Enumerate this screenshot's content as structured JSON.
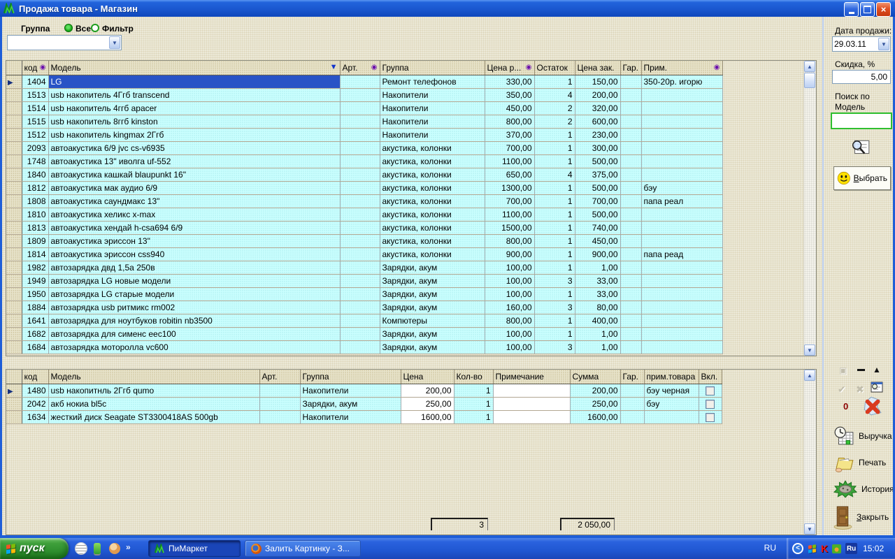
{
  "window": {
    "title": "Продажа товара - Магазин"
  },
  "toolbar": {
    "group_label": "Группа",
    "radio_all_label": "Все",
    "radio_filter_label": "Фильтр",
    "group_value": ""
  },
  "main_table": {
    "headers": [
      {
        "label": "код",
        "icon": "filter"
      },
      {
        "label": "Модель",
        "icon": "sort-desc"
      },
      {
        "label": "Арт.",
        "icon": "filter"
      },
      {
        "label": "Группа"
      },
      {
        "label": "Цена р...",
        "icon": "filter"
      },
      {
        "label": "Остаток"
      },
      {
        "label": "Цена зак."
      },
      {
        "label": "Гар."
      },
      {
        "label": "Прим.",
        "icon": "filter"
      }
    ],
    "selected_row": 0,
    "rows": [
      {
        "code": "1404",
        "model": "LG",
        "art": "",
        "group": "Ремонт телефонов",
        "price": "330,00",
        "stock": "1",
        "purchase": "150,00",
        "gar": "",
        "note": "350-20р. игорю"
      },
      {
        "code": "1513",
        "model": "usb накопитель 4Ггб transcend",
        "art": "",
        "group": "Накопители",
        "price": "350,00",
        "stock": "4",
        "purchase": "200,00",
        "gar": "",
        "note": ""
      },
      {
        "code": "1514",
        "model": "usb накопитель 4ггб apacer",
        "art": "",
        "group": "Накопители",
        "price": "450,00",
        "stock": "2",
        "purchase": "320,00",
        "gar": "",
        "note": ""
      },
      {
        "code": "1515",
        "model": "usb накопитель 8ггб kinston",
        "art": "",
        "group": "Накопители",
        "price": "800,00",
        "stock": "2",
        "purchase": "600,00",
        "gar": "",
        "note": ""
      },
      {
        "code": "1512",
        "model": "usb накопитель kingmax 2Ггб",
        "art": "",
        "group": "Накопители",
        "price": "370,00",
        "stock": "1",
        "purchase": "230,00",
        "gar": "",
        "note": ""
      },
      {
        "code": "2093",
        "model": "автоакустика 6/9 jvc cs-v6935",
        "art": "",
        "group": "акустика, колонки",
        "price": "700,00",
        "stock": "1",
        "purchase": "300,00",
        "gar": "",
        "note": ""
      },
      {
        "code": "1748",
        "model": "автоакустика 13\" иволга uf-552",
        "art": "",
        "group": "акустика, колонки",
        "price": "1100,00",
        "stock": "1",
        "purchase": "500,00",
        "gar": "",
        "note": ""
      },
      {
        "code": "1840",
        "model": "автоакустика кашкай blaupunkt 16\"",
        "art": "",
        "group": "акустика, колонки",
        "price": "650,00",
        "stock": "4",
        "purchase": "375,00",
        "gar": "",
        "note": ""
      },
      {
        "code": "1812",
        "model": "автоакустика мак аудио 6/9",
        "art": "",
        "group": "акустика, колонки",
        "price": "1300,00",
        "stock": "1",
        "purchase": "500,00",
        "gar": "",
        "note": "бэу"
      },
      {
        "code": "1808",
        "model": "автоакустика саундмакс 13\"",
        "art": "",
        "group": "акустика, колонки",
        "price": "700,00",
        "stock": "1",
        "purchase": "700,00",
        "gar": "",
        "note": "папа реал"
      },
      {
        "code": "1810",
        "model": "автоакустика хеликс x-max",
        "art": "",
        "group": "акустика, колонки",
        "price": "1100,00",
        "stock": "1",
        "purchase": "500,00",
        "gar": "",
        "note": ""
      },
      {
        "code": "1813",
        "model": "автоакустика хендай h-csa694 6/9",
        "art": "",
        "group": "акустика, колонки",
        "price": "1500,00",
        "stock": "1",
        "purchase": "740,00",
        "gar": "",
        "note": ""
      },
      {
        "code": "1809",
        "model": "автоакустика эриссон 13\"",
        "art": "",
        "group": "акустика, колонки",
        "price": "800,00",
        "stock": "1",
        "purchase": "450,00",
        "gar": "",
        "note": ""
      },
      {
        "code": "1814",
        "model": "автоакустика эриссон css940",
        "art": "",
        "group": "акустика, колонки",
        "price": "900,00",
        "stock": "1",
        "purchase": "900,00",
        "gar": "",
        "note": "папа реад"
      },
      {
        "code": "1982",
        "model": "автозарядка двд 1,5а 250в",
        "art": "",
        "group": "Зарядки, акум",
        "price": "100,00",
        "stock": "1",
        "purchase": "1,00",
        "gar": "",
        "note": ""
      },
      {
        "code": "1949",
        "model": "автозарядка LG новые модели",
        "art": "",
        "group": "Зарядки, акум",
        "price": "100,00",
        "stock": "3",
        "purchase": "33,00",
        "gar": "",
        "note": ""
      },
      {
        "code": "1950",
        "model": "автозарядка LG старые модели",
        "art": "",
        "group": "Зарядки, акум",
        "price": "100,00",
        "stock": "1",
        "purchase": "33,00",
        "gar": "",
        "note": ""
      },
      {
        "code": "1884",
        "model": "автозарядка usb ритмикс rm002",
        "art": "",
        "group": "Зарядки, акум",
        "price": "160,00",
        "stock": "3",
        "purchase": "80,00",
        "gar": "",
        "note": ""
      },
      {
        "code": "1641",
        "model": "автозарядка для ноутбуков robitin nb3500",
        "art": "",
        "group": "Компютеры",
        "price": "800,00",
        "stock": "1",
        "purchase": "400,00",
        "gar": "",
        "note": ""
      },
      {
        "code": "1682",
        "model": "автозарядка для сименс еес100",
        "art": "",
        "group": "Зарядки, акум",
        "price": "100,00",
        "stock": "1",
        "purchase": "1,00",
        "gar": "",
        "note": ""
      },
      {
        "code": "1684",
        "model": "автозарядка моторолла vc600",
        "art": "",
        "group": "Зарядки, акум",
        "price": "100,00",
        "stock": "3",
        "purchase": "1,00",
        "gar": "",
        "note": ""
      }
    ]
  },
  "cart_table": {
    "headers": [
      {
        "label": "код"
      },
      {
        "label": "Модель"
      },
      {
        "label": "Арт."
      },
      {
        "label": "Группа"
      },
      {
        "label": "Цена"
      },
      {
        "label": "Кол-во"
      },
      {
        "label": "Примечание"
      },
      {
        "label": "Сумма"
      },
      {
        "label": "Гар."
      },
      {
        "label": "прим.товара"
      },
      {
        "label": "Вкл."
      }
    ],
    "selected_row": 0,
    "rows": [
      {
        "code": "1480",
        "model": "usb накопитнль 2Ггб qumo",
        "art": "",
        "group": "Накопители",
        "price": "200,00",
        "qty": "1",
        "note": "",
        "sum": "200,00",
        "gar": "",
        "item_note": "бэу черная"
      },
      {
        "code": "2042",
        "model": "акб нокиа bl5c",
        "art": "",
        "group": "Зарядки, акум",
        "price": "250,00",
        "qty": "1",
        "note": "",
        "sum": "250,00",
        "gar": "",
        "item_note": "бэу"
      },
      {
        "code": "1634",
        "model": "жесткий диск Seagate ST3300418AS 500gb",
        "art": "",
        "group": "Накопители",
        "price": "1600,00",
        "qty": "1",
        "note": "",
        "sum": "1600,00",
        "gar": "",
        "item_note": ""
      }
    ],
    "totals": {
      "count": "3",
      "sum": "2 050,00"
    }
  },
  "sidebar": {
    "date_label": "Дата продажи:",
    "date_value": "29.03.11",
    "discount_label": "Скидка, %",
    "discount_value": "5,00",
    "search_label_line1": "Поиск по",
    "search_label_line2": "Модель",
    "search_value": "",
    "select_button_label": "Выбрать",
    "zero_count": "0",
    "revenue_label": "Выручка",
    "print_label": "Печать",
    "history_label": "История",
    "close_label": "Закрыть"
  },
  "taskbar": {
    "start_label": "пуск",
    "quick_launch_more": "»",
    "tasks": [
      {
        "label": "ПиМаркет"
      },
      {
        "label": "Залить Картинку - З..."
      }
    ],
    "tray": {
      "lang_left": "RU",
      "chevron": "<",
      "ru_badge": "Ru",
      "time": "15:02"
    }
  }
}
